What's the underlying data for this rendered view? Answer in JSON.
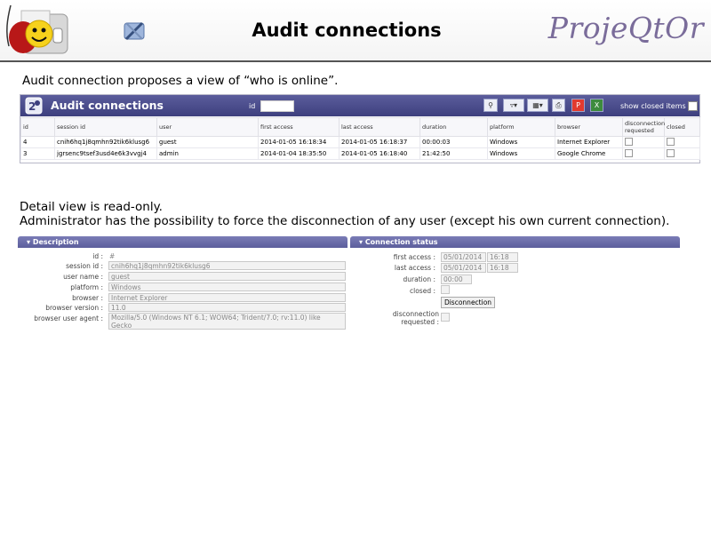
{
  "slide": {
    "title": "Audit connections",
    "brand": "ProjeQtOr",
    "intro": "Audit connection proposes a view of “who is online”.",
    "detail_line1": "Detail view is read-only.",
    "detail_line2": "Administrator has the possibility to force the disconnection of any user (except his own current connection)."
  },
  "app": {
    "title": "Audit connections",
    "id_label": "id",
    "show_closed_label": "show closed items",
    "toolbar_icons": [
      "search-icon",
      "filter-icon",
      "columns-icon",
      "print-icon",
      "pdf-icon",
      "excel-icon"
    ],
    "columns": [
      "id",
      "session id",
      "user",
      "first access",
      "last access",
      "duration",
      "platform",
      "browser",
      "disconnection requested",
      "closed"
    ],
    "rows": [
      {
        "id": "4",
        "session": "cnih6hq1j8qmhn92tik6klusg6",
        "user": "guest",
        "first": "2014-01-05 16:18:34",
        "last": "2014-01-05 16:18:37",
        "duration": "00:00:03",
        "platform": "Windows",
        "browser": "Internet Explorer"
      },
      {
        "id": "3",
        "session": "jgrsenc9tsef3usd4e6k3vvgj4",
        "user": "admin",
        "first": "2014-01-04 18:35:50",
        "last": "2014-01-05 16:18:40",
        "duration": "21:42:50",
        "platform": "Windows",
        "browser": "Google Chrome"
      }
    ]
  },
  "description": {
    "header": "Description",
    "id_label": "id :",
    "id_value": "# 4",
    "session_label": "session id :",
    "session_value": "cnih6hq1j8qmhn92tik6klusg6",
    "user_label": "user name :",
    "user_value": "guest",
    "platform_label": "platform :",
    "platform_value": "Windows",
    "browser_label": "browser :",
    "browser_value": "Internet Explorer",
    "version_label": "browser version :",
    "version_value": "11.0",
    "agent_label": "browser user agent :",
    "agent_value_1": "Mozilla/5.0 (Windows NT 6.1; WOW64; Trident/7.0; rv:11.0) like",
    "agent_value_2": "Gecko"
  },
  "status": {
    "header": "Connection status",
    "first_label": "first access :",
    "first_date": "05/01/2014",
    "first_time": "16:18",
    "last_label": "last access :",
    "last_date": "05/01/2014",
    "last_time": "16:18",
    "duration_label": "duration :",
    "duration_value": "00:00",
    "closed_label": "closed :",
    "disconnect_button": "Disconnection",
    "disc_req_label_1": "disconnection",
    "disc_req_label_2": "requested :"
  }
}
